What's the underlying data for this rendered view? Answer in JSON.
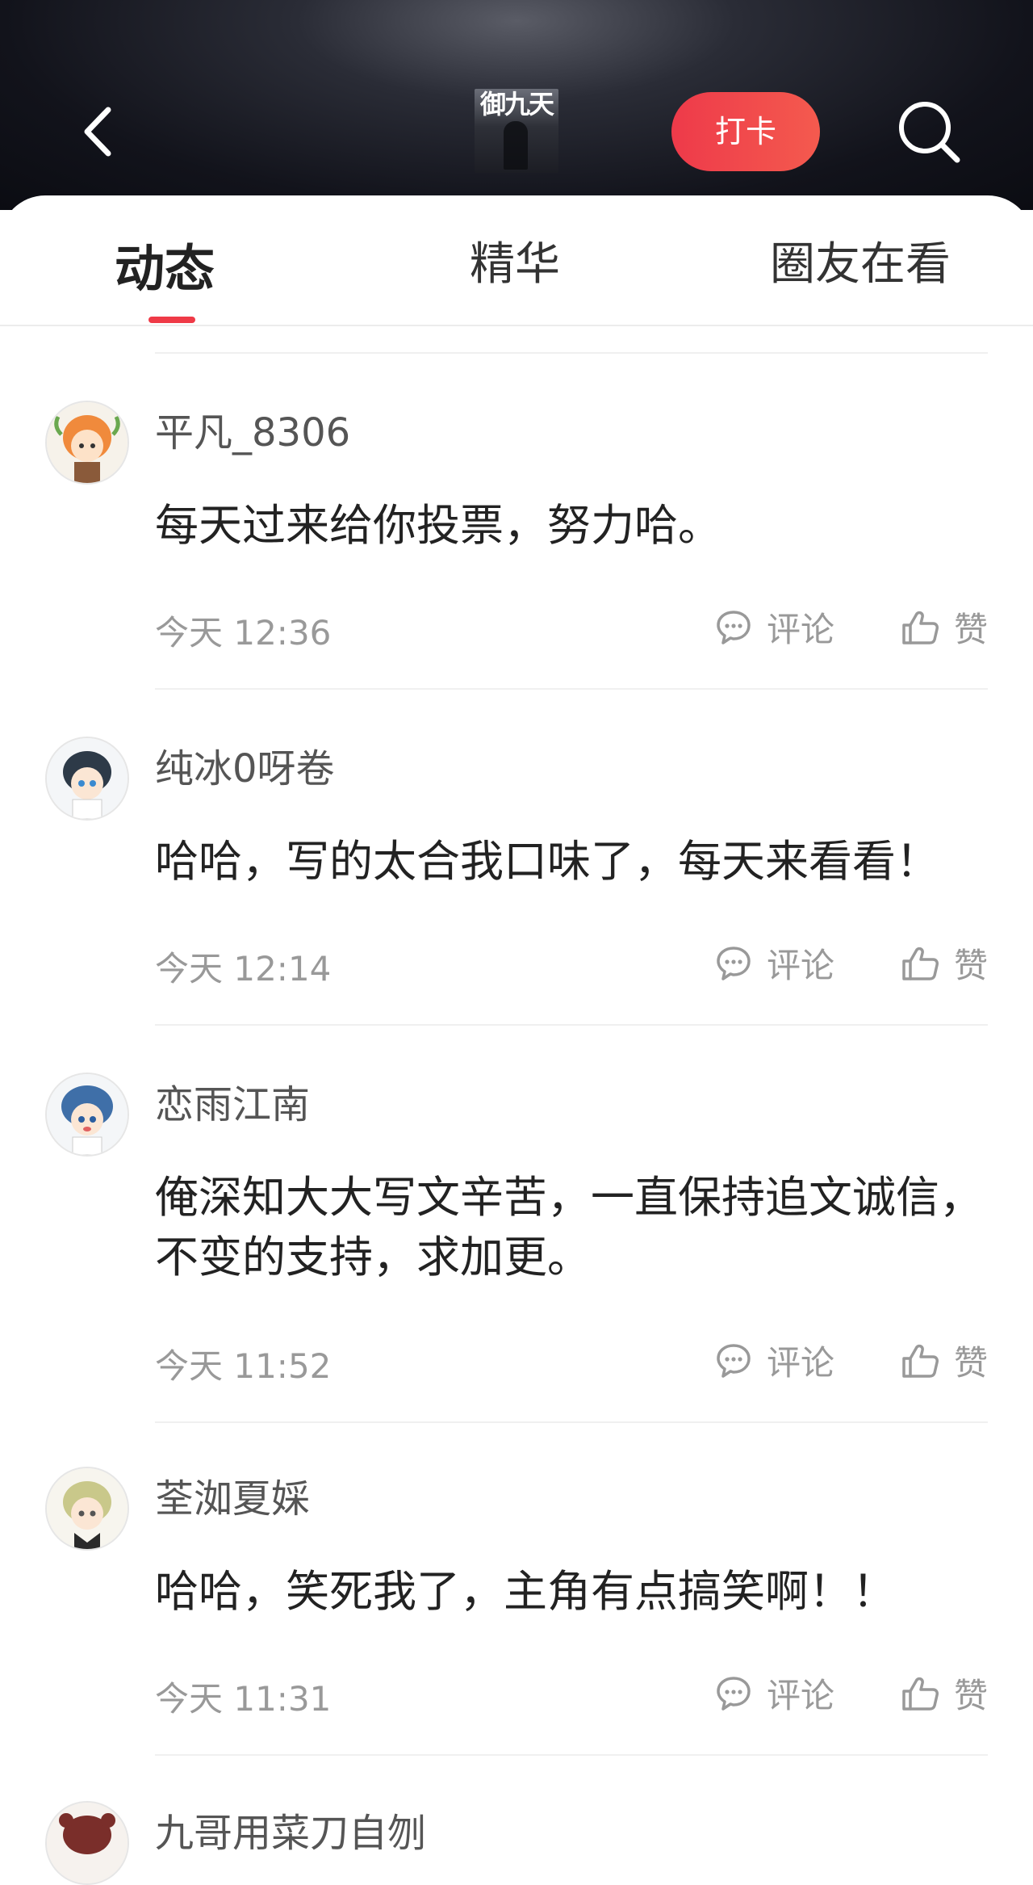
{
  "header": {
    "cover_title": "御九天",
    "checkin_label": "打卡"
  },
  "tabs": [
    {
      "label": "动态",
      "active": true
    },
    {
      "label": "精华",
      "active": false
    },
    {
      "label": "圈友在看",
      "active": false
    }
  ],
  "actions": {
    "comment_label": "评论",
    "like_label": "赞"
  },
  "posts": [
    {
      "username": "平凡_8306",
      "content": "每天过来给你投票，努力哈。",
      "time": "今天 12:36"
    },
    {
      "username": "纯冰0呀卷",
      "content": "哈哈，写的太合我口味了，每天来看看！",
      "time": "今天 12:14"
    },
    {
      "username": "恋雨江南",
      "content": "俺深知大大写文辛苦，一直保持追文诚信，不变的支持，求加更。",
      "time": "今天 11:52"
    },
    {
      "username": "荃洳夏婇",
      "content": "哈哈，笑死我了，主角有点搞笑啊！！",
      "time": "今天 11:31"
    },
    {
      "username": "九哥用菜刀自刎",
      "content": "",
      "time": ""
    }
  ],
  "colors": {
    "accent": "#ef3a47",
    "muted_text": "#999999",
    "divider": "#f0f0f0"
  }
}
